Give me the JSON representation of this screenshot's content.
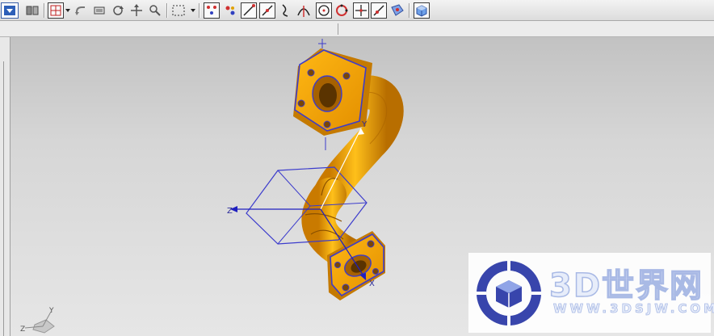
{
  "toolbar": {
    "icons": [
      "selection-filter-dropdown",
      "snap-tools-icon",
      "reset-view-icon",
      "undo-icon",
      "fit-view-icon",
      "rotate-icon",
      "pan-icon",
      "zoom-icon",
      "rectangle-select-icon",
      "point-snap-icon",
      "end-point-icon",
      "line-icon",
      "curve-icon",
      "arc-icon",
      "intersection-icon",
      "circle-center-icon",
      "quadrant-icon",
      "point-on-curve-icon",
      "line-point-icon",
      "surface-point-icon",
      "view-cube-icon"
    ]
  },
  "viewport": {
    "wcs_labels": {
      "y": "Y",
      "z": "Z",
      "x": "X"
    },
    "view_triad_labels": {
      "y": "Y",
      "z": "Z"
    },
    "colors": {
      "part": "#f2a400",
      "selection_edges": "#3c3ccc",
      "background_top": "#c2c2c2",
      "background_bottom": "#e6e6e6"
    }
  },
  "watermark": {
    "title": "3D世界网",
    "url": "WWW.3DSJW.COM",
    "logo_color": "#2c3aa8"
  }
}
